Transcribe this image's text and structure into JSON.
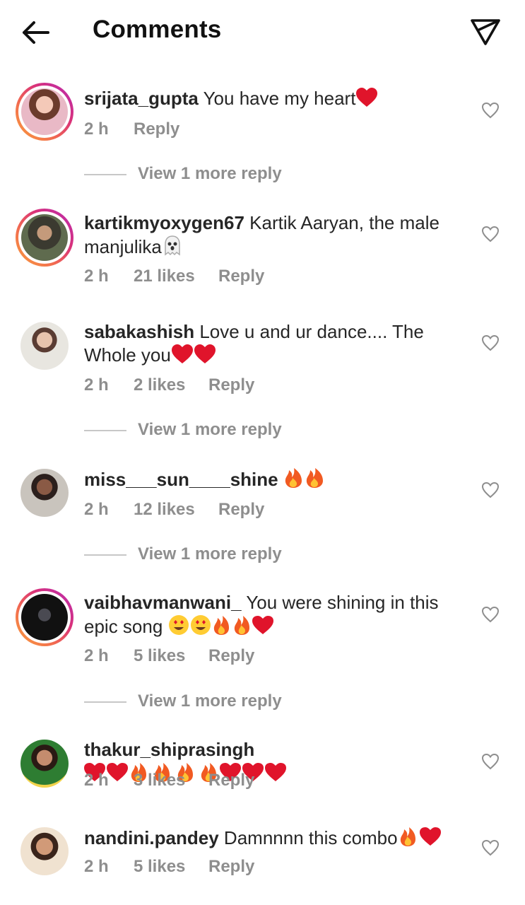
{
  "header": {
    "title": "Comments"
  },
  "comments": [
    {
      "user": "srijata_gupta",
      "text": "You have my heart",
      "time": "2 h",
      "likes": "",
      "reply": "Reply",
      "more": "View 1 more reply"
    },
    {
      "user": "kartikmyoxygen67",
      "text": "Kartik Aaryan, the male",
      "text2": "manjulika",
      "time": "2 h",
      "likes": "21 likes",
      "reply": "Reply"
    },
    {
      "user": "sabakashish",
      "text": "Love u and ur dance.... The",
      "text2": "Whole you",
      "time": "2 h",
      "likes": "2 likes",
      "reply": "Reply",
      "more": "View 1 more reply"
    },
    {
      "user": "miss___sun____shine",
      "text": "",
      "time": "2 h",
      "likes": "12 likes",
      "reply": "Reply",
      "more": "View 1 more reply"
    },
    {
      "user": "vaibhavmanwani_",
      "text": "You were shining in this",
      "text2": "epic song",
      "time": "2 h",
      "likes": "5 likes",
      "reply": "Reply",
      "more": "View 1 more reply"
    },
    {
      "user": "thakur_shiprasingh",
      "text": "",
      "time": "2 h",
      "likes": "3 likes",
      "reply": "Reply"
    },
    {
      "user": "nandini.pandey",
      "text": "Damnnnn this combo",
      "time": "2 h",
      "likes": "5 likes",
      "reply": "Reply"
    }
  ]
}
